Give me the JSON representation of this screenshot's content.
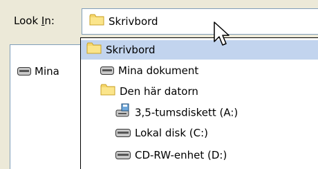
{
  "look_in": {
    "label_prefix": "Look ",
    "label_hotkey": "I",
    "label_suffix": "n:"
  },
  "combo": {
    "value": "Skrivbord",
    "icon": "folder-icon"
  },
  "file_pane": {
    "items": [
      {
        "label": "Mina",
        "icon": "drive-icon"
      }
    ]
  },
  "dropdown": {
    "items": [
      {
        "label": "Skrivbord",
        "icon": "folder-icon",
        "selected": true
      },
      {
        "label": "Mina dokument",
        "icon": "drive-icon"
      },
      {
        "label": "Den här datorn",
        "icon": "folder-icon"
      },
      {
        "label": "3,5-tumsdiskett (A:)",
        "icon": "floppy-drive-icon"
      },
      {
        "label": "Lokal disk (C:)",
        "icon": "drive-icon"
      },
      {
        "label": "CD-RW-enhet (D:)",
        "icon": "cd-drive-icon"
      }
    ]
  },
  "colors": {
    "window_bg": "#ece9d8",
    "border": "#7f9db9",
    "selection": "#c2d4ee",
    "folder": "#f5d66b"
  }
}
